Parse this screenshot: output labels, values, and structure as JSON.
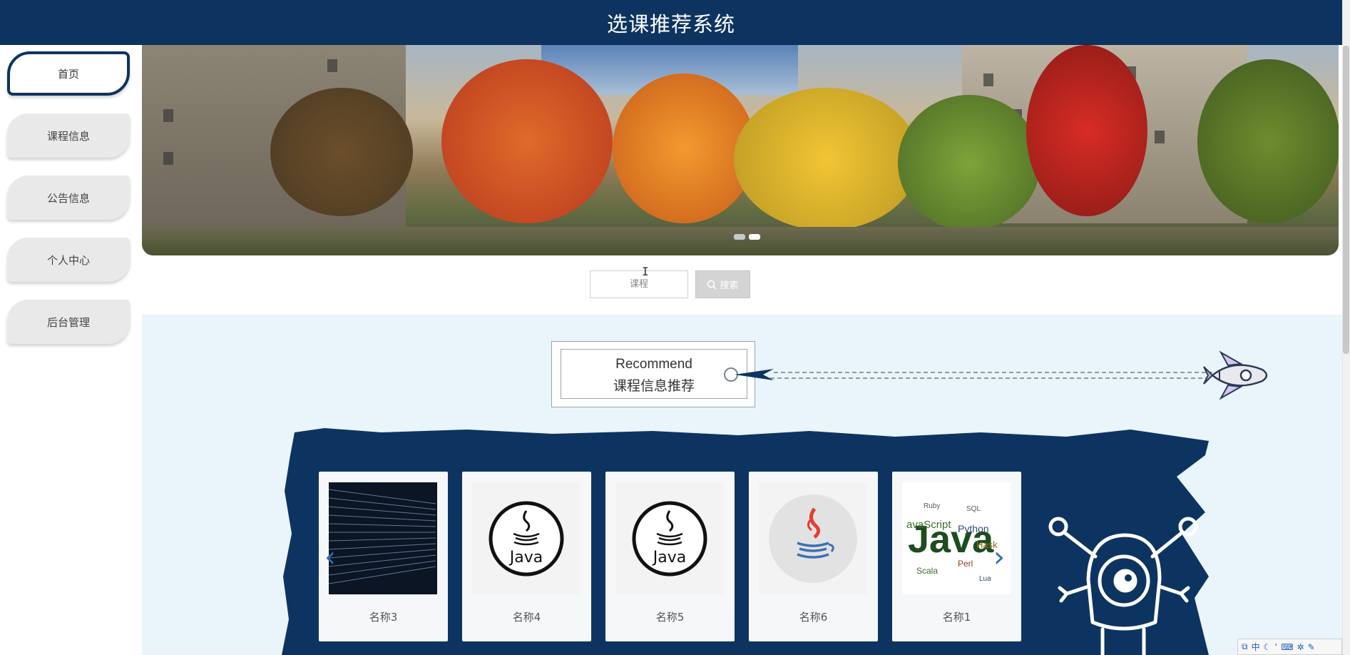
{
  "header": {
    "title": "选课推荐系统"
  },
  "sidebar": {
    "items": [
      {
        "label": "首页",
        "active": true
      },
      {
        "label": "课程信息",
        "active": false
      },
      {
        "label": "公告信息",
        "active": false
      },
      {
        "label": "个人中心",
        "active": false
      },
      {
        "label": "后台管理",
        "active": false
      }
    ]
  },
  "banner": {
    "image": "campus-autumn-trees-photo",
    "slides": 2,
    "active_slide": 2
  },
  "search": {
    "value": "课程",
    "button_label": "搜索",
    "button_icon": "search-icon"
  },
  "recommend": {
    "title_en": "Recommend",
    "title_cn": "课程信息推荐",
    "decoration_icon": "rocket-icon"
  },
  "courses": [
    {
      "name": "名称3",
      "image": "code-wall-image"
    },
    {
      "name": "名称4",
      "image": "java-logo-circle"
    },
    {
      "name": "名称5",
      "image": "java-logo-circle"
    },
    {
      "name": "名称6",
      "image": "java-cup-logo"
    },
    {
      "name": "名称1",
      "image": "java-word-cloud"
    }
  ],
  "carousel": {
    "prev_icon": "chevron-left-icon",
    "next_icon": "chevron-right-icon"
  },
  "mascot": {
    "icon": "monster-mascot-icon"
  },
  "tray": {
    "items": [
      "中"
    ]
  },
  "colors": {
    "primary": "#0d3461",
    "content_bg": "#e9f4fb",
    "nav_bg": "#e9e9e9",
    "arrow": "#2e6db4"
  }
}
